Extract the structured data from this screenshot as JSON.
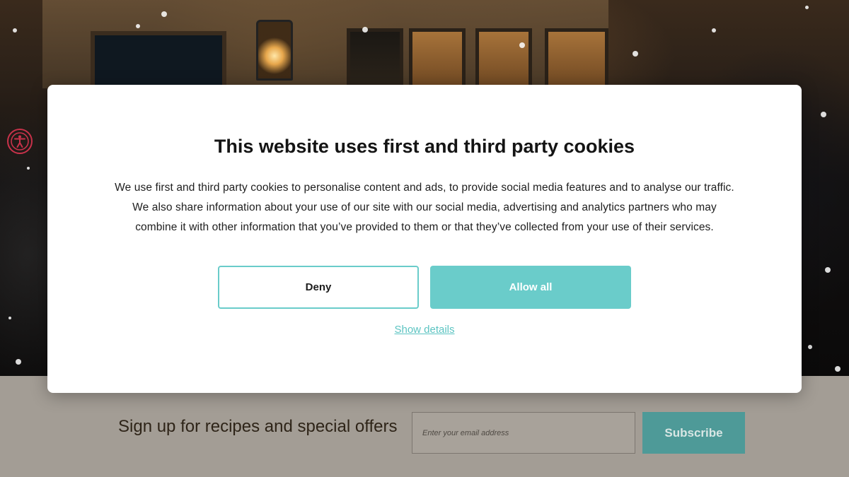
{
  "cookie_dialog": {
    "title": "This website uses first and third party cookies",
    "body_lines": [
      "We use first and third party cookies to personalise content and ads, to provide social media features and to analyse our traffic.",
      "We also share information about your use of our site with our social media, advertising and analytics partners who may",
      "combine it with other information that you’ve provided to them or that they’ve collected from your use of their services."
    ],
    "deny_label": "Deny",
    "allow_label": "Allow all",
    "details_link": "Show details"
  },
  "newsletter": {
    "label": "Sign up for recipes and special offers",
    "email_placeholder": "Enter your email address",
    "subscribe_label": "Subscribe"
  },
  "accessibility": {
    "icon": "accessibility-icon"
  },
  "colors": {
    "accent": "#6accca",
    "subscribe": "#4e9a98",
    "accessibility": "#c8324a",
    "strip": "#a39d95"
  }
}
